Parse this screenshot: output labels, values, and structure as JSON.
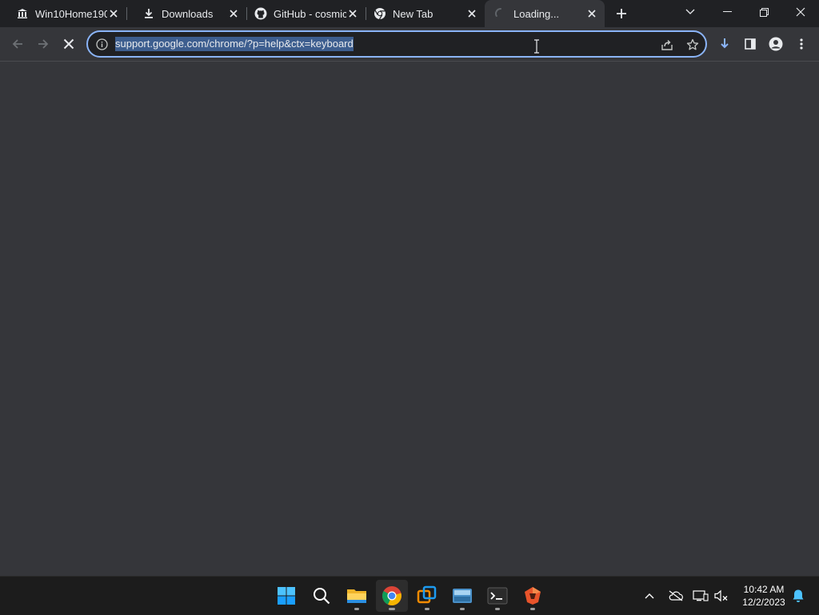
{
  "tabs": [
    {
      "title": "Win10Home190",
      "icon": "bank-icon"
    },
    {
      "title": "Downloads",
      "icon": "download-icon"
    },
    {
      "title": "GitHub - cosmic",
      "icon": "github-icon"
    },
    {
      "title": "New Tab",
      "icon": "chrome-icon"
    },
    {
      "title": "Loading...",
      "icon": "spinner-icon",
      "active": true
    }
  ],
  "omnibox": {
    "url": "support.google.com/chrome/?p=help&ctx=keyboard"
  },
  "clock": {
    "time": "10:42 AM",
    "date": "12/2/2023"
  },
  "colors": {
    "tabstrip": "#202124",
    "toolbar": "#35363a",
    "focus_ring": "#8ab4f8",
    "url_selection": "#3d5e8f",
    "taskbar": "#1c1c1c"
  }
}
